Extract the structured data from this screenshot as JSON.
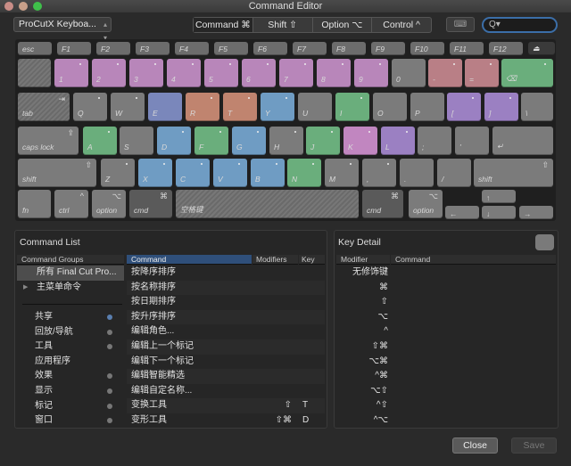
{
  "window": {
    "title": "Command Editor"
  },
  "toolbar": {
    "keyset": "ProCutX Keyboa...",
    "modifiers": [
      "Command ⌘",
      "Shift ⇧",
      "Option ⌥",
      "Control ^"
    ],
    "selected_modifier": "Command ⌘",
    "search_placeholder": "",
    "search_icon": "Q▾",
    "keyboard_icon": "⌨"
  },
  "colors": {
    "gray": "#7b7b7b",
    "pink": "#b886ba",
    "rose": "#b97f86",
    "green": "#6aae7c",
    "blue": "#6f9cc3",
    "indigo": "#7a87bb",
    "salmon": "#c0846f",
    "purple": "#9b80c2",
    "magenta": "#c186c0",
    "dark": "#5a5a5a",
    "fn": "#6c6c6c"
  },
  "keyboard": {
    "frow": [
      "esc",
      "F1",
      "F2",
      "F3",
      "F4",
      "F5",
      "F6",
      "F7",
      "F8",
      "F9",
      "F10",
      "F11",
      "F12",
      "⏏"
    ],
    "rows": [
      [
        {
          "l": "",
          "c": "hatch"
        },
        {
          "l": "1",
          "c": "pink",
          "d": 1
        },
        {
          "l": "2",
          "c": "pink",
          "d": 1
        },
        {
          "l": "3",
          "c": "pink",
          "d": 1
        },
        {
          "l": "4",
          "c": "pink",
          "d": 1
        },
        {
          "l": "5",
          "c": "pink",
          "d": 1
        },
        {
          "l": "6",
          "c": "pink",
          "d": 1
        },
        {
          "l": "7",
          "c": "pink",
          "d": 1
        },
        {
          "l": "8",
          "c": "pink",
          "d": 1
        },
        {
          "l": "9",
          "c": "pink",
          "d": 1
        },
        {
          "l": "0",
          "c": "gray"
        },
        {
          "l": "-",
          "c": "rose",
          "d": 1
        },
        {
          "l": "=",
          "c": "rose",
          "d": 1
        },
        {
          "l": "⌫",
          "c": "green",
          "d": 1
        }
      ],
      [
        {
          "l": "tab",
          "c": "hatch",
          "s": "⇥"
        },
        {
          "l": "Q",
          "c": "gray",
          "d": 1
        },
        {
          "l": "W",
          "c": "gray",
          "d": 1
        },
        {
          "l": "E",
          "c": "indigo"
        },
        {
          "l": "R",
          "c": "salmon",
          "d": 1
        },
        {
          "l": "T",
          "c": "salmon",
          "d": 1
        },
        {
          "l": "Y",
          "c": "blue",
          "d": 1
        },
        {
          "l": "U",
          "c": "gray"
        },
        {
          "l": "I",
          "c": "green",
          "d": 1
        },
        {
          "l": "O",
          "c": "gray"
        },
        {
          "l": "P",
          "c": "gray"
        },
        {
          "l": "[",
          "c": "purple",
          "d": 1
        },
        {
          "l": "]",
          "c": "purple",
          "d": 1
        },
        {
          "l": "\\",
          "c": "gray"
        }
      ],
      [
        {
          "l": "caps lock",
          "c": "gray",
          "s": "⇪"
        },
        {
          "l": "A",
          "c": "green",
          "d": 1
        },
        {
          "l": "S",
          "c": "gray"
        },
        {
          "l": "D",
          "c": "blue",
          "d": 1
        },
        {
          "l": "F",
          "c": "green",
          "d": 1
        },
        {
          "l": "G",
          "c": "blue",
          "d": 1
        },
        {
          "l": "H",
          "c": "gray",
          "d": 1
        },
        {
          "l": "J",
          "c": "green",
          "d": 1
        },
        {
          "l": "K",
          "c": "magenta",
          "d": 1
        },
        {
          "l": "L",
          "c": "purple",
          "d": 1
        },
        {
          "l": ";",
          "c": "gray"
        },
        {
          "l": "'",
          "c": "gray"
        },
        {
          "l": "↵",
          "c": "gray"
        }
      ],
      [
        {
          "l": "shift",
          "c": "gray",
          "s": "⇧"
        },
        {
          "l": "Z",
          "c": "gray",
          "d": 1
        },
        {
          "l": "X",
          "c": "blue",
          "d": 1
        },
        {
          "l": "C",
          "c": "blue",
          "d": 1
        },
        {
          "l": "V",
          "c": "blue",
          "d": 1
        },
        {
          "l": "B",
          "c": "blue",
          "d": 1
        },
        {
          "l": "N",
          "c": "green",
          "d": 1
        },
        {
          "l": "M",
          "c": "gray",
          "d": 1
        },
        {
          "l": ",",
          "c": "gray",
          "d": 1
        },
        {
          "l": ".",
          "c": "gray"
        },
        {
          "l": "/",
          "c": "gray"
        },
        {
          "l": "shift",
          "c": "gray",
          "s": "⇧"
        }
      ],
      [
        {
          "l": "fn",
          "c": "gray"
        },
        {
          "l": "ctrl",
          "c": "gray",
          "s": "^"
        },
        {
          "l": "option",
          "c": "gray",
          "s": "⌥"
        },
        {
          "l": "cmd",
          "c": "dark",
          "s": "⌘"
        },
        {
          "l": "空格键",
          "c": "hatch"
        },
        {
          "l": "cmd",
          "c": "dark",
          "s": "⌘"
        },
        {
          "l": "option",
          "c": "gray",
          "s": "⌥"
        },
        {
          "l": "↑",
          "c": "gray"
        },
        {
          "l": "←",
          "c": "gray"
        },
        {
          "l": "↓",
          "c": "gray"
        },
        {
          "l": "→",
          "c": "gray"
        }
      ]
    ]
  },
  "command_list": {
    "title": "Command List",
    "groups_header": "Command Groups",
    "groups": [
      {
        "label": "所有 Final Cut Pro...",
        "selected": true
      },
      {
        "label": "主菜单命令",
        "expander": "▶"
      }
    ],
    "categories": [
      {
        "label": "共享",
        "dot": "#5a7fb0"
      },
      {
        "label": "回放/导航",
        "dot": "#777"
      },
      {
        "label": "工具",
        "dot": "#777"
      },
      {
        "label": "应用程序",
        "dot": ""
      },
      {
        "label": "效果",
        "dot": "#777"
      },
      {
        "label": "显示",
        "dot": "#777"
      },
      {
        "label": "标记",
        "dot": "#777"
      },
      {
        "label": "窗口",
        "dot": "#777"
      }
    ],
    "columns": [
      "Command",
      "Modifiers",
      "Key"
    ],
    "commands": [
      [
        "按降序排序",
        "",
        ""
      ],
      [
        "按名称排序",
        "",
        ""
      ],
      [
        "按日期排序",
        "",
        ""
      ],
      [
        "按升序排序",
        "",
        ""
      ],
      [
        "编辑角色...",
        "",
        ""
      ],
      [
        "编辑上一个标记",
        "",
        ""
      ],
      [
        "编辑下一个标记",
        "",
        ""
      ],
      [
        "编辑智能精选",
        "",
        ""
      ],
      [
        "编辑自定名称...",
        "",
        ""
      ],
      [
        "变换工具",
        "⇧",
        "T"
      ],
      [
        "变形工具",
        "⇧⌘",
        "D"
      ]
    ]
  },
  "key_detail": {
    "title": "Key Detail",
    "columns": [
      "Modifier",
      "Command"
    ],
    "modifiers": [
      "无修饰键",
      "⌘",
      "⇧",
      "⌥",
      "^",
      "⇧⌘",
      "⌥⌘",
      "^⌘",
      "⌥⇧",
      "^⇧",
      "^⌥"
    ]
  },
  "footer": {
    "close": "Close",
    "save": "Save"
  }
}
